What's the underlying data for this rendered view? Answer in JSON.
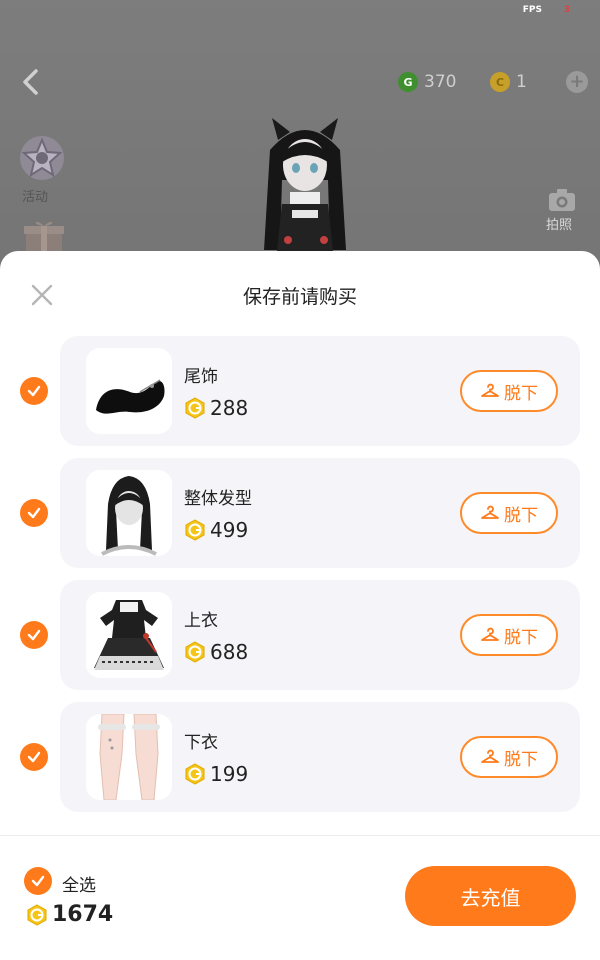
{
  "status": {
    "fps_label": "FPS",
    "fps_value": "3"
  },
  "topbar": {
    "g_coins": "370",
    "coins": "1",
    "g_coin_icon": "g-coin-icon",
    "coin_icon": "coin-icon",
    "plus_icon": "plus-icon"
  },
  "side": {
    "event_label": "活动",
    "camera_label": "拍照"
  },
  "sheet": {
    "title": "保存前请购买",
    "items": [
      {
        "name": "尾饰",
        "price": "288",
        "remove_label": "脱下",
        "thumb": "tail-icon"
      },
      {
        "name": "整体发型",
        "price": "499",
        "remove_label": "脱下",
        "thumb": "hairstyle-icon"
      },
      {
        "name": "上衣",
        "price": "688",
        "remove_label": "脱下",
        "thumb": "dress-icon"
      },
      {
        "name": "下衣",
        "price": "199",
        "remove_label": "脱下",
        "thumb": "legwear-icon"
      }
    ],
    "select_all": "全选",
    "total": "1674",
    "recharge": "去充值"
  },
  "colors": {
    "accent": "#ff7a1a",
    "gem": "#f5c518",
    "card_bg": "#f5f4f8"
  }
}
